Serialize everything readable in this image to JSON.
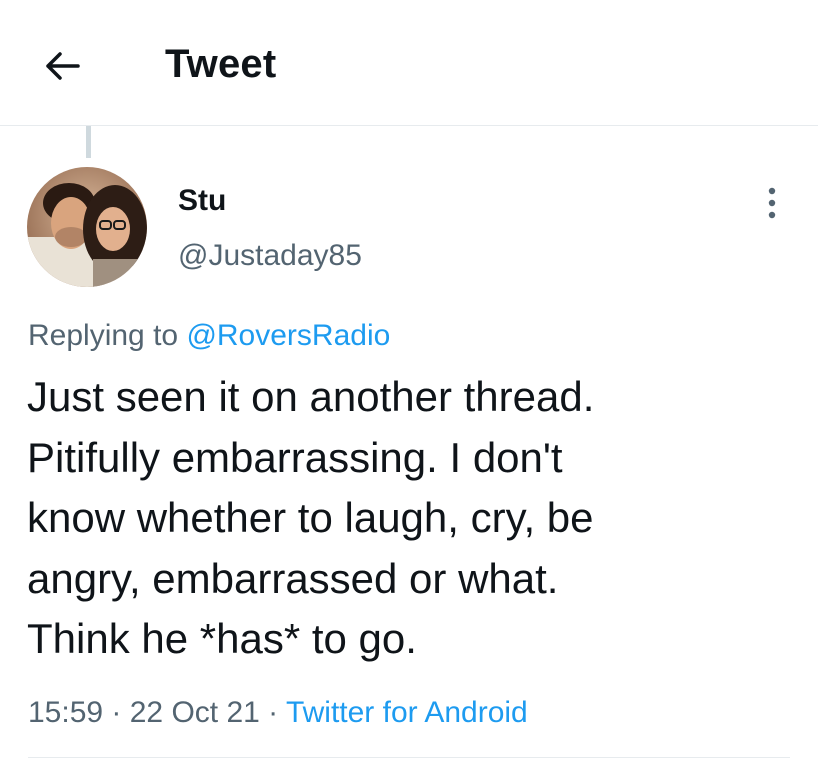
{
  "header": {
    "title": "Tweet",
    "back_icon": "arrow-left-icon"
  },
  "tweet": {
    "author": {
      "display_name": "Stu",
      "handle": "@Justaday85",
      "avatar": "profile-photo"
    },
    "more_icon": "vertical-ellipsis-icon",
    "reply_context": {
      "prefix": "Replying to ",
      "mention": "@RoversRadio"
    },
    "text_lines": [
      "Just seen it on another thread.",
      "Pitifully embarrassing. I don't",
      "know whether to laugh, cry, be",
      "angry, embarrassed or what.",
      "Think he *has* to go."
    ],
    "meta": {
      "time": "15:59",
      "date": "22 Oct 21",
      "separator": " · ",
      "source": "Twitter for Android"
    }
  },
  "colors": {
    "text": "#0f1419",
    "secondary": "#536471",
    "link": "#1d9bf0",
    "divider": "#e7ebee"
  }
}
